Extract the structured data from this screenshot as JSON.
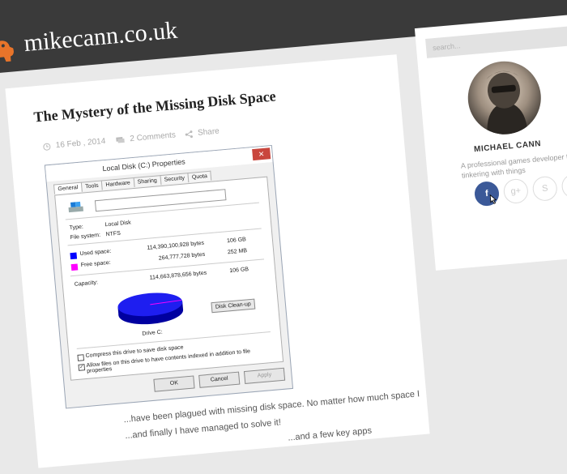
{
  "site": {
    "title": "mikecann.co.uk"
  },
  "post": {
    "title": "The Mystery of the Missing Disk Space",
    "date": "16 Feb , 2014",
    "comments": "2 Comments",
    "share": "Share",
    "body_lines": [
      "...have been plagued with missing disk space. No matter how much space I",
      "...and finally I have managed to solve it!",
      "...and a few key apps"
    ]
  },
  "dialog": {
    "title": "Local Disk (C:) Properties",
    "close": "✕",
    "tabs": [
      "General",
      "Tools",
      "Hardware",
      "Sharing",
      "Security",
      "Quota"
    ],
    "type_label": "Type:",
    "type_value": "Local Disk",
    "fs_label": "File system:",
    "fs_value": "NTFS",
    "used_label": "Used space:",
    "used_bytes": "114,390,100,928 bytes",
    "used_size": "106 GB",
    "free_label": "Free space:",
    "free_bytes": "264,777,728 bytes",
    "free_size": "252 MB",
    "capacity_label": "Capacity:",
    "capacity_bytes": "114,663,878,656 bytes",
    "capacity_size": "106 GB",
    "drive_label": "Drive C:",
    "cleanup": "Disk Clean-up",
    "compress": "Compress this drive to save disk space",
    "index": "Allow files on this drive to have contents indexed in addition to file properties",
    "index_checked": "✓",
    "ok": "OK",
    "cancel": "Cancel",
    "apply": "Apply",
    "colors": {
      "used": "#0000ff",
      "free": "#ff00ff"
    }
  },
  "sidebar": {
    "search_placeholder": "search...",
    "author_name": "MICHAEL CANN",
    "author_bio": "A professional games developer tha... stop tinkering with things",
    "social": [
      {
        "icon": "facebook-icon",
        "label": "f"
      },
      {
        "icon": "google-plus-icon",
        "label": "g+"
      },
      {
        "icon": "skype-icon",
        "label": "S"
      },
      {
        "icon": "twitter-icon",
        "label": "t"
      }
    ]
  },
  "colors": {
    "header": "#3a3a3a",
    "accent": "#3b5998",
    "logo": "#e8742a"
  }
}
